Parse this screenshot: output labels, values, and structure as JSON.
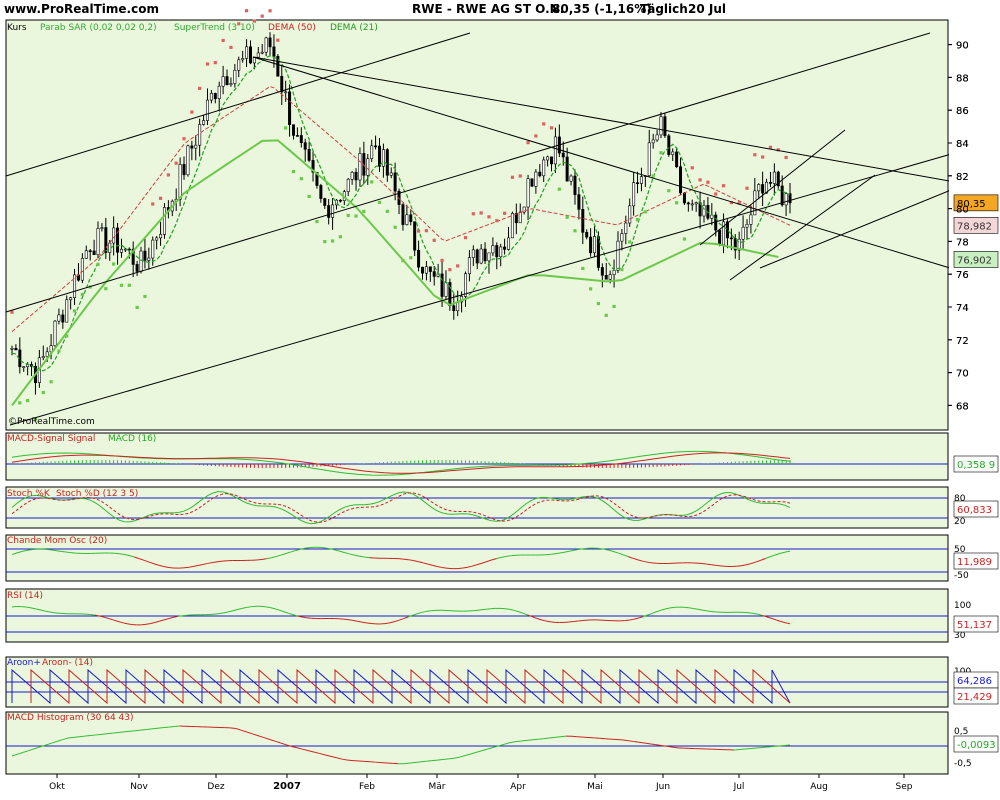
{
  "header": {
    "site": "www.ProRealTime.com",
    "title": "RWE - RWE AG ST O.N.",
    "quote": "80,35 (-1,16%)",
    "period": "Täglich",
    "date": "20 Jul"
  },
  "watermark": "©ProRealTime.com",
  "colors": {
    "panel_bg": "#eaf7dd",
    "price": "#000000",
    "sar": "#e06060",
    "supertrend_up": "#6cc84a",
    "supertrend_down": "#e07070",
    "dema50": "#d04040",
    "dema21": "#20a020",
    "green": "#33bb33",
    "red": "#cc2222",
    "blue": "#1a1acc"
  },
  "panels": {
    "main": {
      "legend": [
        {
          "text": "Kurs",
          "color": "#000000"
        },
        {
          "text": "Parab SAR (0,02 0,02 0,2)",
          "color": "#33aa33"
        },
        {
          "text": "SuperTrend (3 10)",
          "color": "#33aa33"
        },
        {
          "text": "DEMA (50)",
          "color": "#cc2222"
        },
        {
          "text": "DEMA (21)",
          "color": "#229922"
        }
      ],
      "last_price_label": "80,35",
      "dema50_label": "78,982",
      "supertrend_label": "76,902"
    },
    "macd": {
      "legend": [
        {
          "text": "MACD-Signal Signal",
          "color": "#cc2222"
        },
        {
          "text": "MACD (16)",
          "color": "#22aa22"
        }
      ],
      "value_label": "0,358",
      "value_label_suffix": "9"
    },
    "stoch": {
      "legend": [
        {
          "text": "Stoch %K",
          "color": "#cc2222"
        },
        {
          "text": "Stoch %D (12 3 5)",
          "color": "#cc2222"
        }
      ],
      "axis_top": "80",
      "axis_bottom": "20",
      "value_label": "60,833"
    },
    "cmo": {
      "legend": [
        {
          "text": "Chande Mom Osc (20)",
          "color": "#cc2222"
        }
      ],
      "axis_top": "50",
      "axis_bottom": "-50",
      "value_label": "11,989"
    },
    "rsi": {
      "legend": [
        {
          "text": "RSI (14)",
          "color": "#cc2222"
        }
      ],
      "axis_top": "100",
      "axis_bottom": "30",
      "value_label": "51,137"
    },
    "aroon": {
      "legend": [
        {
          "text": "Aroon+",
          "color": "#1a1acc"
        },
        {
          "text": "Aroon- (14)",
          "color": "#cc2222"
        }
      ],
      "axis_top": "100",
      "value_label_up": "64,286",
      "value_label_down": "21,429"
    },
    "macd_hist": {
      "legend": [
        {
          "text": "MACD Histogram (30 64 43)",
          "color": "#cc2222"
        }
      ],
      "axis_top": "0,5",
      "axis_bottom": "-0,5",
      "value_label": "-0,0093"
    }
  },
  "chart_data": {
    "type": "line",
    "title": "RWE - RWE AG ST O.N.",
    "xlabel": "",
    "ylabel": "",
    "x_ticks": [
      "Okt",
      "Nov",
      "Dez",
      "2007",
      "Feb",
      "Mär",
      "Apr",
      "Mai",
      "Jun",
      "Jul",
      "Aug",
      "Sep"
    ],
    "y_ticks": [
      68,
      70,
      72,
      74,
      76,
      78,
      80,
      82,
      84,
      86,
      88,
      90
    ],
    "ylim": [
      66.5,
      91.5
    ],
    "grid": false,
    "legend_position": "top-left",
    "last_price": 80.35,
    "change_percent": -1.16,
    "series": [
      {
        "name": "Kurs",
        "x": [
          "Sep",
          "Okt",
          "Okt",
          "Okt",
          "Nov",
          "Nov",
          "Nov",
          "Dez",
          "Dez",
          "Dez",
          "2007",
          "2007",
          "Jan",
          "Feb",
          "Feb",
          "Feb",
          "Mär",
          "Mär",
          "Mär",
          "Apr",
          "Apr",
          "Apr",
          "Mai",
          "Mai",
          "Mai",
          "Jun",
          "Jun",
          "Jun",
          "Jul",
          "Jul",
          "Jul"
        ],
        "values": [
          71.5,
          70.0,
          74.0,
          78.0,
          78.0,
          76.5,
          80.0,
          84.0,
          88.0,
          89.0,
          90.0,
          84.0,
          80.0,
          81.5,
          84.0,
          80.0,
          76.0,
          74.5,
          77.5,
          78.0,
          82.0,
          84.0,
          79.0,
          76.0,
          81.0,
          85.0,
          80.0,
          79.0,
          77.5,
          82.0,
          80.35
        ]
      },
      {
        "name": "DEMA (50)",
        "x": [
          "Okt",
          "Nov",
          "Dez",
          "2007",
          "Feb",
          "Mär",
          "Apr",
          "Mai",
          "Jun",
          "Jul"
        ],
        "values": [
          72.5,
          77.0,
          84.0,
          87.5,
          83.0,
          78.0,
          80.0,
          79.0,
          81.5,
          78.982
        ]
      },
      {
        "name": "SuperTrend (3 10)",
        "x": [
          "Okt",
          "Nov",
          "Dez",
          "2007",
          "Feb",
          "Mär",
          "Apr",
          "Mai",
          "Jun",
          "Jul"
        ],
        "values": [
          68.0,
          75.0,
          81.0,
          84.5,
          80.0,
          74.0,
          76.0,
          75.5,
          78.0,
          76.902
        ]
      }
    ]
  }
}
